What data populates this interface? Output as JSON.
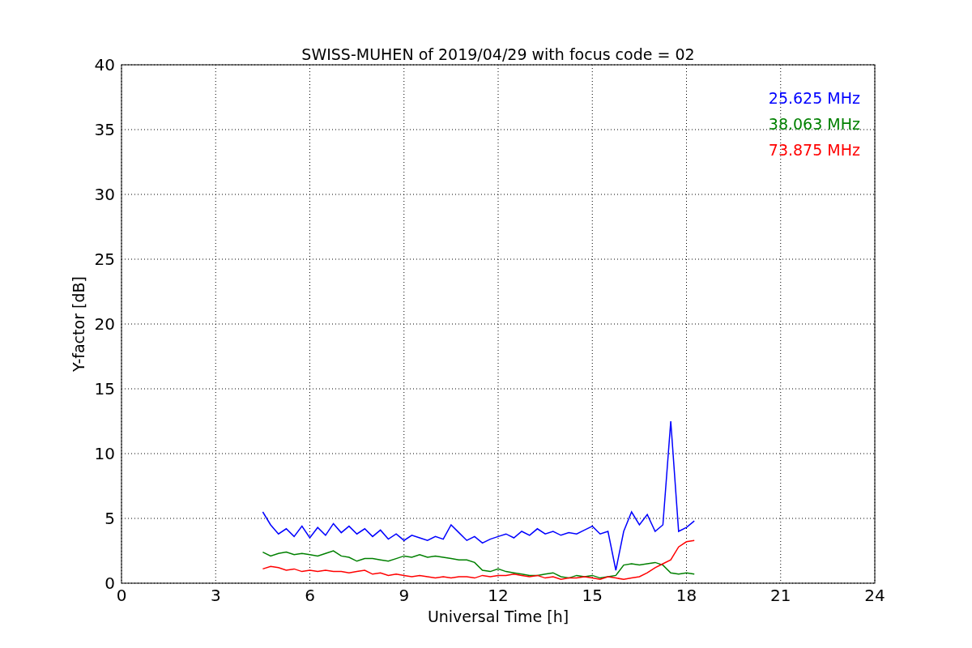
{
  "chart_data": {
    "type": "line",
    "title": "SWISS-MUHEN of 2019/04/29 with focus code = 02",
    "xlabel": "Universal Time [h]",
    "ylabel": "Y-factor [dB]",
    "x": [
      4.5,
      4.75,
      5,
      5.25,
      5.5,
      5.75,
      6,
      6.25,
      6.5,
      6.75,
      7,
      7.25,
      7.5,
      7.75,
      8,
      8.25,
      8.5,
      8.75,
      9,
      9.25,
      9.5,
      9.75,
      10,
      10.25,
      10.5,
      10.75,
      11,
      11.25,
      11.5,
      11.75,
      12,
      12.25,
      12.5,
      12.75,
      13,
      13.25,
      13.5,
      13.75,
      14,
      14.25,
      14.5,
      14.75,
      15,
      15.25,
      15.5,
      15.75,
      16,
      16.25,
      16.5,
      16.75,
      17,
      17.25,
      17.5,
      17.75,
      18,
      18.25
    ],
    "series": [
      {
        "name": "25.625 MHz",
        "color": "#0000ff",
        "values": [
          5.5,
          4.5,
          3.8,
          4.2,
          3.6,
          4.4,
          3.5,
          4.3,
          3.7,
          4.6,
          3.9,
          4.4,
          3.8,
          4.2,
          3.6,
          4.1,
          3.4,
          3.8,
          3.3,
          3.7,
          3.5,
          3.3,
          3.6,
          3.4,
          4.5,
          3.9,
          3.3,
          3.6,
          3.1,
          3.4,
          3.6,
          3.8,
          3.5,
          4.0,
          3.7,
          4.2,
          3.8,
          4.0,
          3.7,
          3.9,
          3.8,
          4.1,
          4.4,
          3.8,
          4.0,
          1.0,
          4.0,
          5.5,
          4.5,
          5.3,
          4.0,
          4.5,
          12.5,
          4.0,
          4.3,
          4.8
        ]
      },
      {
        "name": "38.063 MHz",
        "color": "#008000",
        "values": [
          2.4,
          2.1,
          2.3,
          2.4,
          2.2,
          2.3,
          2.2,
          2.1,
          2.3,
          2.5,
          2.1,
          2.0,
          1.7,
          1.9,
          1.9,
          1.8,
          1.7,
          1.9,
          2.1,
          2.0,
          2.2,
          2.0,
          2.1,
          2.0,
          1.9,
          1.8,
          1.8,
          1.6,
          1.0,
          0.9,
          1.1,
          0.9,
          0.8,
          0.7,
          0.6,
          0.6,
          0.7,
          0.8,
          0.5,
          0.4,
          0.6,
          0.5,
          0.6,
          0.4,
          0.5,
          0.6,
          1.4,
          1.5,
          1.4,
          1.5,
          1.6,
          1.4,
          0.8,
          0.7,
          0.8,
          0.7
        ]
      },
      {
        "name": "73.875 MHz",
        "color": "#ff0000",
        "values": [
          1.1,
          1.3,
          1.2,
          1.0,
          1.1,
          0.9,
          1.0,
          0.9,
          1.0,
          0.9,
          0.9,
          0.8,
          0.9,
          1.0,
          0.7,
          0.8,
          0.6,
          0.7,
          0.6,
          0.5,
          0.6,
          0.5,
          0.4,
          0.5,
          0.4,
          0.5,
          0.5,
          0.4,
          0.6,
          0.5,
          0.6,
          0.6,
          0.7,
          0.6,
          0.5,
          0.6,
          0.4,
          0.5,
          0.3,
          0.4,
          0.4,
          0.5,
          0.4,
          0.3,
          0.5,
          0.4,
          0.3,
          0.4,
          0.5,
          0.8,
          1.2,
          1.5,
          1.8,
          2.8,
          3.2,
          3.3
        ]
      }
    ],
    "xlim": [
      0,
      24
    ],
    "ylim": [
      0,
      40
    ],
    "xticks": [
      0,
      3,
      6,
      9,
      12,
      15,
      18,
      21,
      24
    ],
    "yticks": [
      0,
      5,
      10,
      15,
      20,
      25,
      30,
      35,
      40
    ],
    "grid": true
  }
}
